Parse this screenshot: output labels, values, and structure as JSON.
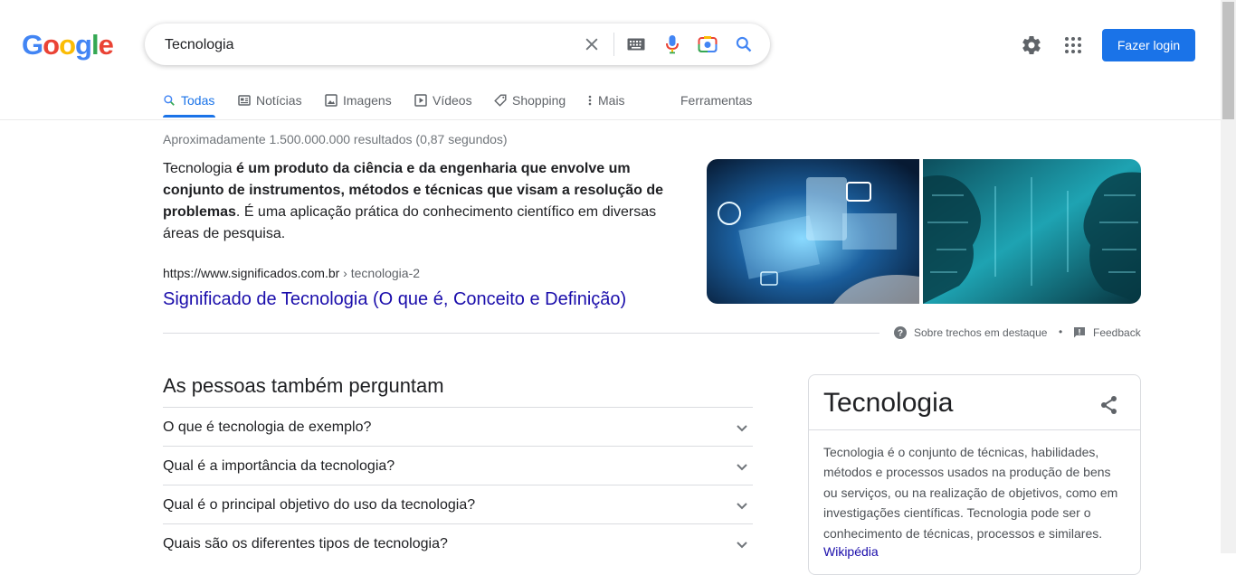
{
  "logo": {
    "g1": "G",
    "o1": "o",
    "o2": "o",
    "g2": "g",
    "l": "l",
    "e": "e"
  },
  "search": {
    "value": "Tecnologia"
  },
  "header": {
    "login_label": "Fazer login"
  },
  "tabs": [
    {
      "label": "Todas",
      "icon": "search-icon"
    },
    {
      "label": "Notícias",
      "icon": "news-icon"
    },
    {
      "label": "Imagens",
      "icon": "image-icon"
    },
    {
      "label": "Vídeos",
      "icon": "video-icon"
    },
    {
      "label": "Shopping",
      "icon": "tag-icon"
    },
    {
      "label": "Mais",
      "icon": "more-vert-icon"
    },
    {
      "label": "Ferramentas"
    }
  ],
  "results": {
    "stats": "Aproximadamente 1.500.000.000 resultados (0,87 segundos)",
    "snippet": {
      "start": "Tecnologia",
      "bold": " é um produto da ciência e da engenharia que envolve um conjunto de instrumentos, métodos e técnicas que visam a resolução de problemas",
      "rest": ". É uma aplicação prática do conhecimento científico em diversas áreas de pesquisa."
    },
    "url": "https://www.significados.com.br",
    "url_crumb": " › tecnologia-2",
    "title": "Significado de Tecnologia (O que é, Conceito e Definição)",
    "about_label": "Sobre trechos em destaque",
    "separator": "•",
    "feedback_label": "Feedback"
  },
  "paa": {
    "title": "As pessoas também perguntam",
    "questions": [
      "O que é tecnologia de exemplo?",
      "Qual é a importância da tecnologia?",
      "Qual é o principal objetivo do uso da tecnologia?",
      "Quais são os diferentes tipos de tecnologia?"
    ]
  },
  "knowledge_panel": {
    "title": "Tecnologia",
    "description": "Tecnologia é o conjunto de técnicas, habilidades, métodos e processos usados na produção de bens ou serviços, ou na realização de objetivos, como em investigações científicas. Tecnologia pode ser o conhecimento de técnicas, processos e similares.",
    "source": "Wikipédia"
  },
  "colors": {
    "accent": "#1a73e8",
    "link": "#1a0dab"
  }
}
